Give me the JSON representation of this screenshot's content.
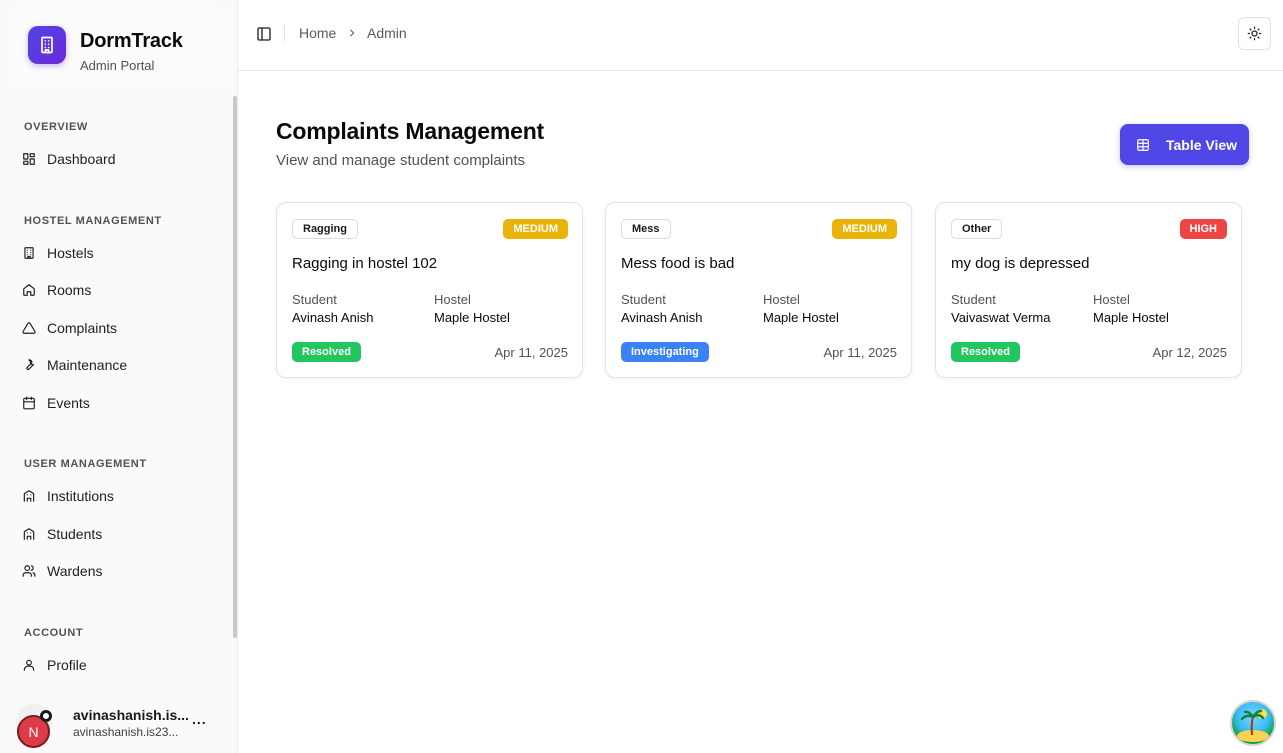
{
  "brand": {
    "name": "DormTrack",
    "subtitle": "Admin Portal"
  },
  "sidebar": {
    "sections": [
      {
        "label": "OVERVIEW"
      },
      {
        "label": "HOSTEL MANAGEMENT"
      },
      {
        "label": "USER MANAGEMENT"
      },
      {
        "label": "ACCOUNT"
      }
    ],
    "items": [
      {
        "label": "Dashboard",
        "icon": "dashboard-icon"
      },
      {
        "label": "Hostels",
        "icon": "building-icon"
      },
      {
        "label": "Rooms",
        "icon": "home-icon"
      },
      {
        "label": "Complaints",
        "icon": "alert-triangle-icon"
      },
      {
        "label": "Maintenance",
        "icon": "wrench-icon"
      },
      {
        "label": "Events",
        "icon": "calendar-icon"
      },
      {
        "label": "Institutions",
        "icon": "school-icon"
      },
      {
        "label": "Students",
        "icon": "school-icon"
      },
      {
        "label": "Wardens",
        "icon": "users-icon"
      },
      {
        "label": "Profile",
        "icon": "user-icon"
      }
    ]
  },
  "user": {
    "initial": "N",
    "name": "avinashanish.is...",
    "email": "avinashanish.is23...",
    "more": "..."
  },
  "header": {
    "breadcrumb": [
      "Home",
      "Admin"
    ]
  },
  "main": {
    "title": "Complaints Management",
    "subtitle": "View and manage student complaints",
    "table_view_label": "Table View",
    "labels": {
      "student": "Student",
      "hostel": "Hostel"
    }
  },
  "complaints": [
    {
      "category": "Ragging",
      "priority": "MEDIUM",
      "priority_color": "#eab308",
      "title": "Ragging in hostel 102",
      "student": "Avinash Anish",
      "hostel": "Maple Hostel",
      "status": "Resolved",
      "status_color": "#22c55e",
      "date": "Apr 11, 2025"
    },
    {
      "category": "Mess",
      "priority": "MEDIUM",
      "priority_color": "#eab308",
      "title": "Mess food is bad",
      "student": "Avinash Anish",
      "hostel": "Maple Hostel",
      "status": "Investigating",
      "status_color": "#3b82f6",
      "date": "Apr 11, 2025"
    },
    {
      "category": "Other",
      "priority": "HIGH",
      "priority_color": "#ef4444",
      "title": "my dog is depressed",
      "student": "Vaivaswat Verma",
      "hostel": "Maple Hostel",
      "status": "Resolved",
      "status_color": "#22c55e",
      "date": "Apr 12, 2025"
    }
  ],
  "colors": {
    "accent": "#4f46e5",
    "medium": "#eab308",
    "high": "#ef4444",
    "resolved": "#22c55e",
    "investigating": "#3b82f6"
  }
}
